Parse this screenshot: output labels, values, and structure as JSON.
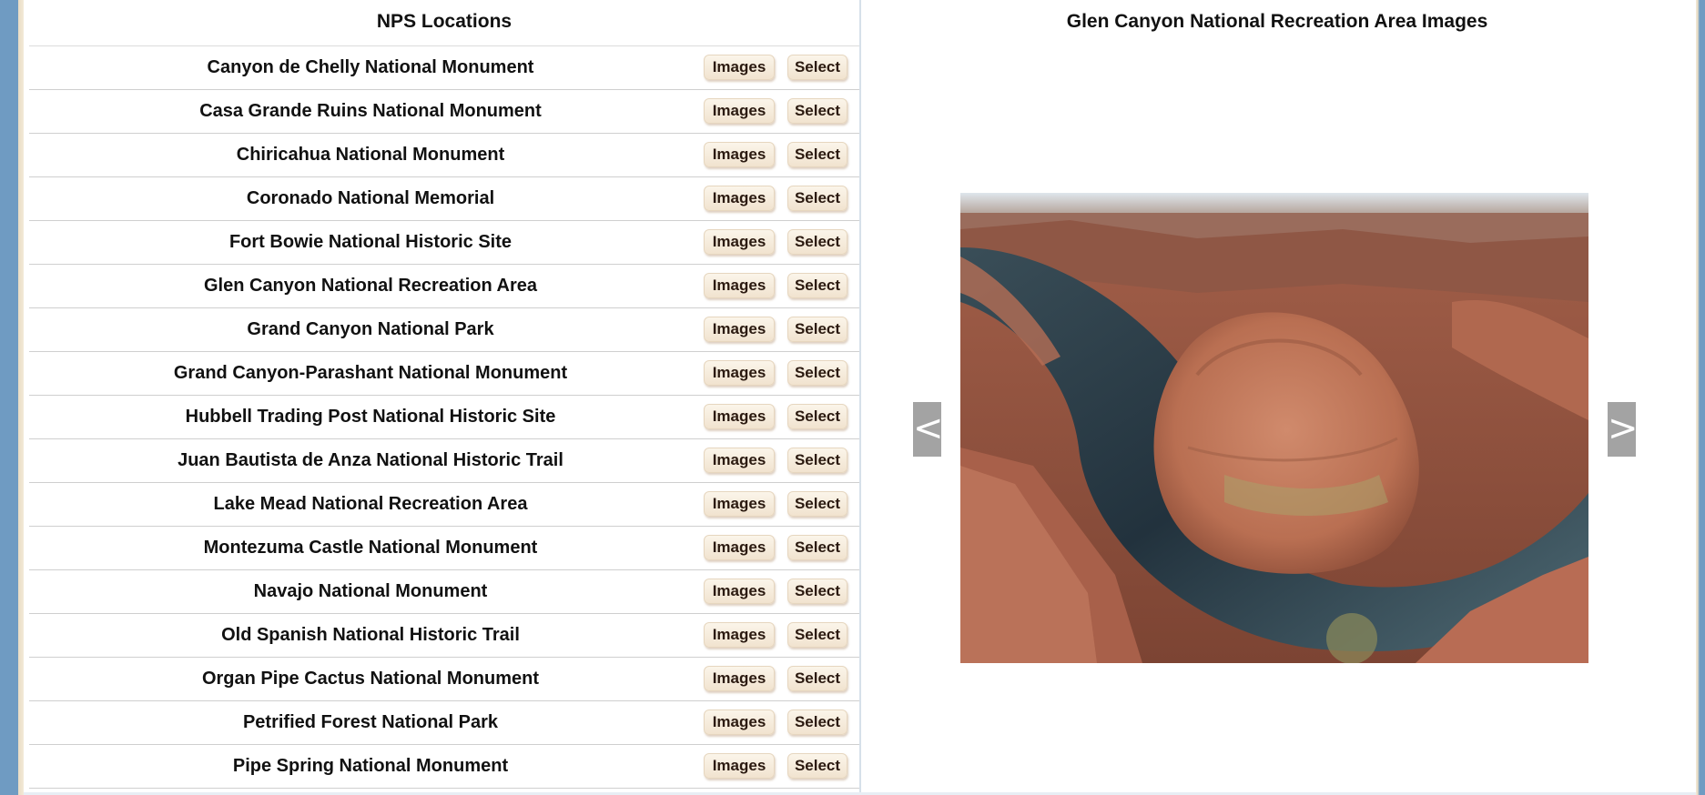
{
  "left_panel": {
    "title": "NPS Locations",
    "images_label": "Images",
    "select_label": "Select",
    "locations": [
      "Canyon de Chelly National Monument",
      "Casa Grande Ruins National Monument",
      "Chiricahua National Monument",
      "Coronado National Memorial",
      "Fort Bowie National Historic Site",
      "Glen Canyon National Recreation Area",
      "Grand Canyon National Park",
      "Grand Canyon-Parashant National Monument",
      "Hubbell Trading Post National Historic Site",
      "Juan Bautista de Anza National Historic Trail",
      "Lake Mead National Recreation Area",
      "Montezuma Castle National Monument",
      "Navajo National Monument",
      "Old Spanish National Historic Trail",
      "Organ Pipe Cactus National Monument",
      "Petrified Forest National Park",
      "Pipe Spring National Monument"
    ]
  },
  "right_panel": {
    "title": "Glen Canyon National Recreation Area Images",
    "prev_label": "<",
    "next_label": ">",
    "photo_icon": "horseshoe-bend-photo"
  }
}
